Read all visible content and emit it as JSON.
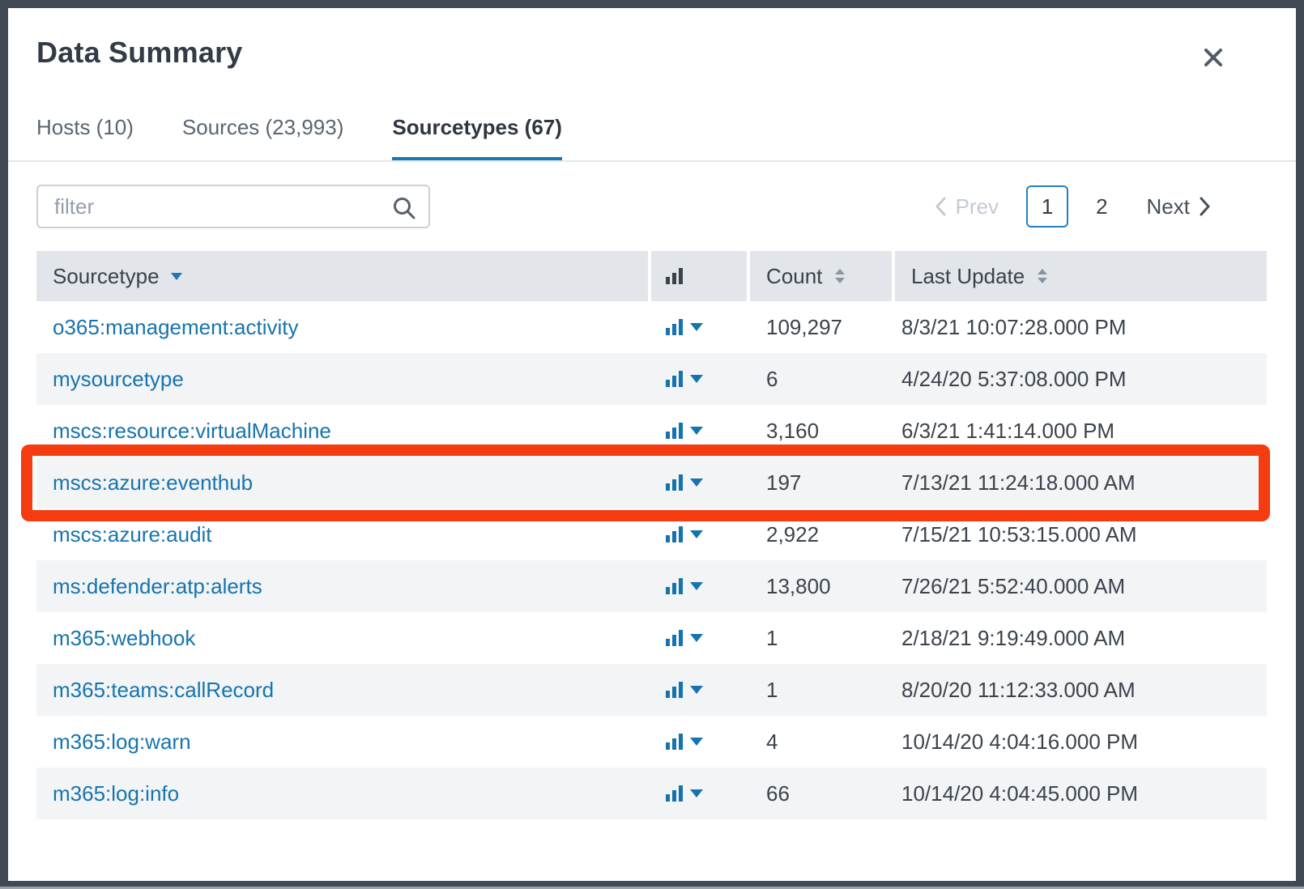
{
  "window": {
    "title": "Data Summary"
  },
  "icons": {
    "close": "x-icon (✕)",
    "search": "magnifier (⌕)",
    "sort_desc": "filled down triangle (▾)",
    "sort_both": "up-down triangles (⬍)",
    "chart": "bar-chart glyph",
    "dropdown_caret": "filled down triangle (▾)",
    "prev_chevron": "left chevron (‹)",
    "next_chevron": "right chevron (›)"
  },
  "tabs": [
    {
      "label": "Hosts (10)",
      "active": false
    },
    {
      "label": "Sources (23,993)",
      "active": false
    },
    {
      "label": "Sourcetypes (67)",
      "active": true
    }
  ],
  "filter": {
    "placeholder": "filter",
    "value": ""
  },
  "pagination": {
    "prev_label": "Prev",
    "next_label": "Next",
    "pages": [
      "1",
      "2"
    ],
    "current_page": "1",
    "prev_disabled": true
  },
  "table": {
    "columns": {
      "sourcetype": "Sourcetype",
      "count": "Count",
      "last_update": "Last Update"
    },
    "sort": {
      "column": "Sourcetype",
      "direction": "desc"
    },
    "rows": [
      {
        "sourcetype": "o365:management:activity",
        "count": "109,297",
        "last_update": "8/3/21 10:07:28.000 PM",
        "highlighted": false
      },
      {
        "sourcetype": "mysourcetype",
        "count": "6",
        "last_update": "4/24/20 5:37:08.000 PM",
        "highlighted": false
      },
      {
        "sourcetype": "mscs:resource:virtualMachine",
        "count": "3,160",
        "last_update": "6/3/21 1:41:14.000 PM",
        "highlighted": false
      },
      {
        "sourcetype": "mscs:azure:eventhub",
        "count": "197",
        "last_update": "7/13/21 11:24:18.000 AM",
        "highlighted": true
      },
      {
        "sourcetype": "mscs:azure:audit",
        "count": "2,922",
        "last_update": "7/15/21 10:53:15.000 AM",
        "highlighted": false
      },
      {
        "sourcetype": "ms:defender:atp:alerts",
        "count": "13,800",
        "last_update": "7/26/21 5:52:40.000 AM",
        "highlighted": false
      },
      {
        "sourcetype": "m365:webhook",
        "count": "1",
        "last_update": "2/18/21 9:19:49.000 AM",
        "highlighted": false
      },
      {
        "sourcetype": "m365:teams:callRecord",
        "count": "1",
        "last_update": "8/20/20 11:12:33.000 AM",
        "highlighted": false
      },
      {
        "sourcetype": "m365:log:warn",
        "count": "4",
        "last_update": "10/14/20 4:04:16.000 PM",
        "highlighted": false
      },
      {
        "sourcetype": "m365:log:info",
        "count": "66",
        "last_update": "10/14/20 4:04:45.000 PM",
        "highlighted": false
      }
    ]
  },
  "colors": {
    "link_blue": "#1774ae",
    "icon_blue": "#1673ae",
    "active_tab_underline": "#1a78b4",
    "current_page_border": "#2180c2",
    "highlight_red": "#f53b10",
    "header_row_bg": "#e2e6ea",
    "alt_row_bg": "#f2f4f6",
    "dark_text": "#3b434c",
    "muted_text": "#5a6570",
    "disabled_text": "#c2cad2",
    "frame_dark": "#414a54"
  }
}
